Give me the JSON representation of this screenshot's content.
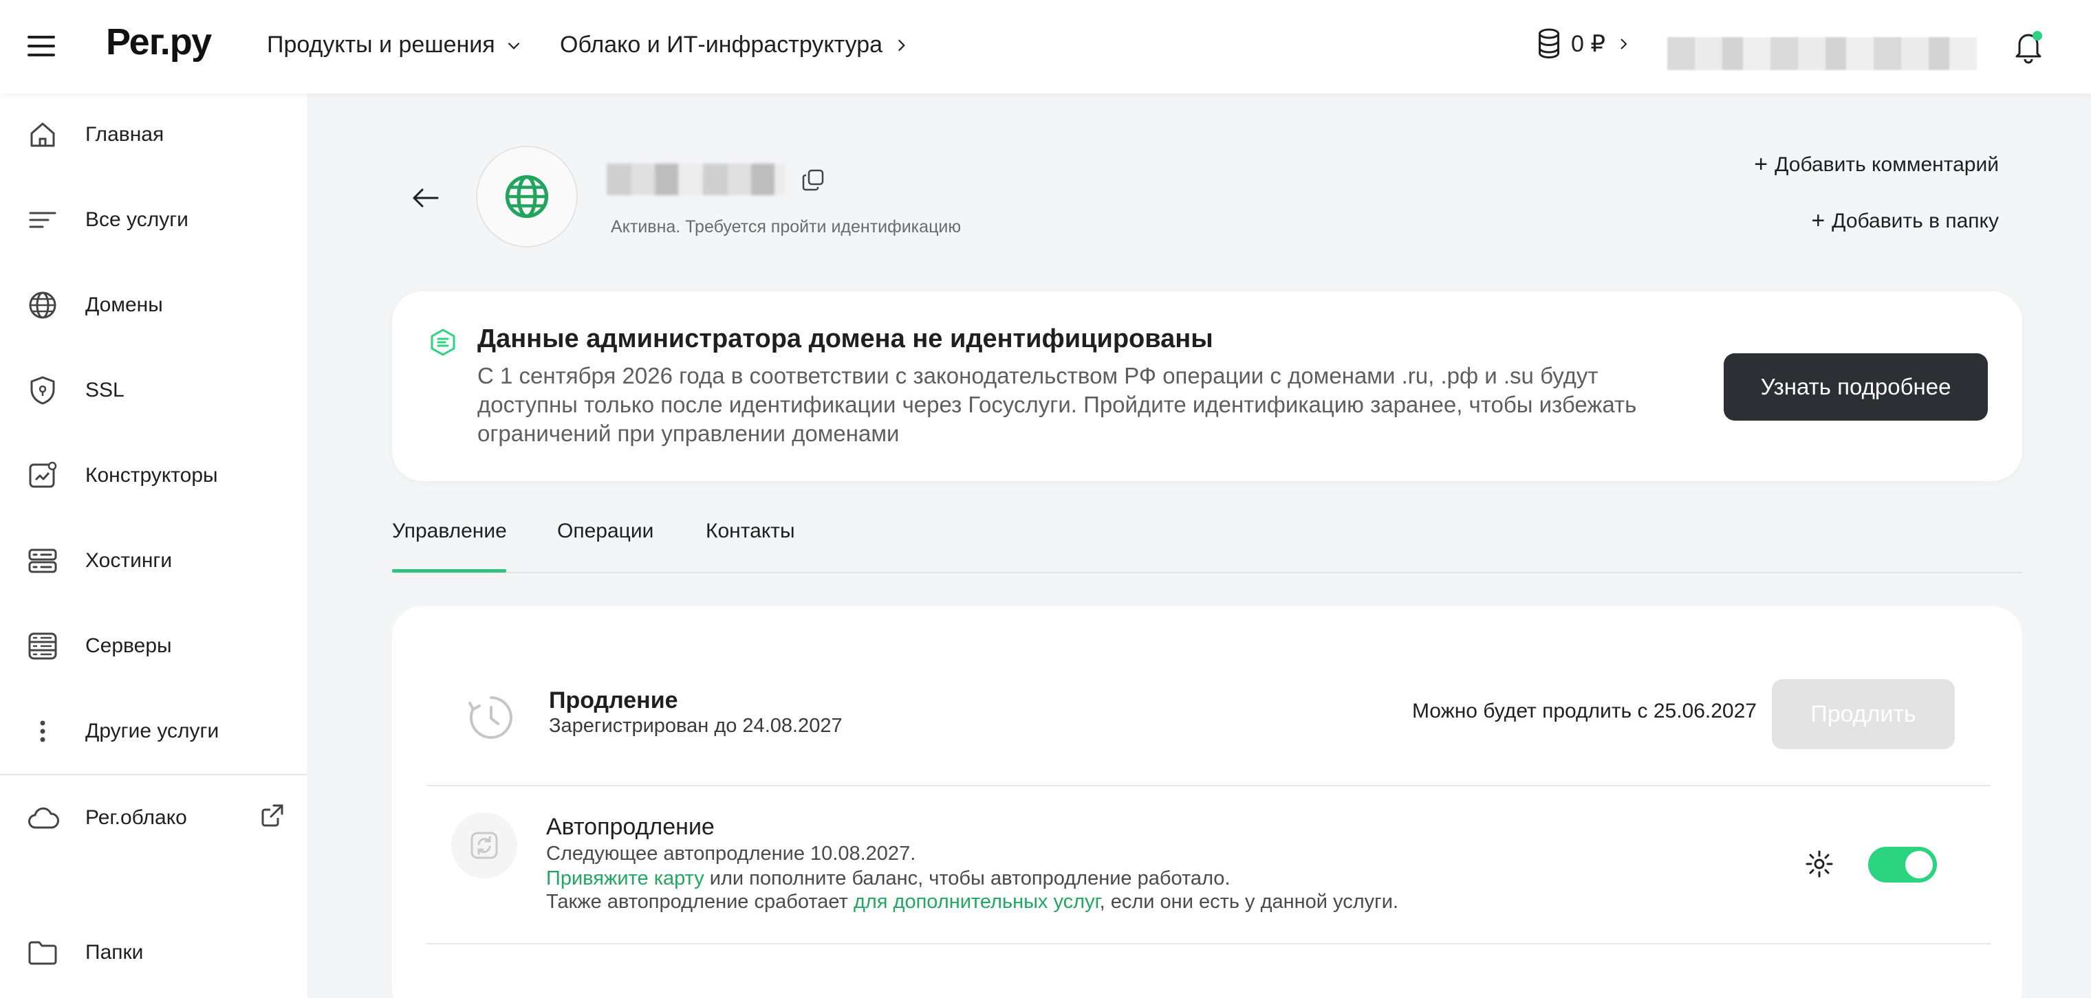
{
  "header": {
    "logo": "Рег.ру",
    "nav": [
      "Продукты и решения",
      "Облако и ИТ-инфраструктура"
    ],
    "balance": "0 ₽"
  },
  "sidebar": {
    "items": [
      {
        "label": "Главная",
        "icon": "home-icon"
      },
      {
        "label": "Все услуги",
        "icon": "list-icon"
      },
      {
        "label": "Домены",
        "icon": "globe-icon"
      },
      {
        "label": "SSL",
        "icon": "shield-icon"
      },
      {
        "label": "Конструкторы",
        "icon": "constructor-icon"
      },
      {
        "label": "Хостинги",
        "icon": "hosting-icon"
      },
      {
        "label": "Серверы",
        "icon": "server-icon"
      },
      {
        "label": "Другие услуги",
        "icon": "more-icon"
      }
    ],
    "cloud": {
      "label": "Рег.облако",
      "icon": "cloud-icon"
    },
    "folders": {
      "label": "Папки",
      "icon": "folder-icon"
    }
  },
  "domain": {
    "status": "Активна. Требуется пройти идентификацию",
    "add_comment": "Добавить комментарий",
    "add_folder": "Добавить в папку"
  },
  "alert": {
    "title": "Данные администратора домена не идентифицированы",
    "text": "С 1 сентября 2026 года в соответствии с законодательством РФ операции с доменами .ru, .рф и .su будут доступны только после идентификации через Госуслуги. Пройдите идентификацию заранее, чтобы избежать ограничений при управлении доменами",
    "button": "Узнать подробнее"
  },
  "tabs": [
    {
      "label": "Управление",
      "active": true
    },
    {
      "label": "Операции",
      "active": false
    },
    {
      "label": "Контакты",
      "active": false
    }
  ],
  "renewal": {
    "title": "Продление",
    "subtitle": "Зарегистрирован до 24.08.2027",
    "note": "Можно будет продлить с 25.06.2027",
    "button": "Продлить"
  },
  "autorenew": {
    "title": "Автопродление",
    "line1": "Следующее автопродление 10.08.2027.",
    "line2_link": "Привяжите карту",
    "line2_rest": " или пополните баланс, чтобы автопродление работало.",
    "line3_start": "Также автопродление сработает ",
    "line3_link": "для дополнительных услуг",
    "line3_end": ", если они есть у данной услуги.",
    "enabled": true
  },
  "colors": {
    "accent": "#2dd47f",
    "link": "#20a862",
    "dark_button": "#2c2f33"
  }
}
